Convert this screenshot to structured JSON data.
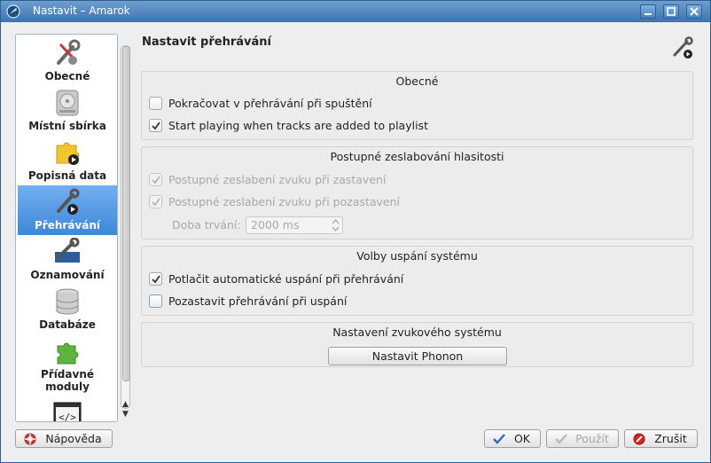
{
  "window": {
    "title": "Nastavit – Amarok"
  },
  "sidebar": {
    "items": [
      {
        "label": "Obecné",
        "icon": "wrench-screwdriver-icon",
        "selected": false
      },
      {
        "label": "Místní sbírka",
        "icon": "hard-drive-icon",
        "selected": false
      },
      {
        "label": "Popisná data",
        "icon": "puzzle-play-icon",
        "selected": false
      },
      {
        "label": "Přehrávání",
        "icon": "playback-tools-icon",
        "selected": true
      },
      {
        "label": "Oznamování",
        "icon": "notification-tools-icon",
        "selected": false
      },
      {
        "label": "Databáze",
        "icon": "database-icon",
        "selected": false
      },
      {
        "label": "Přídavné moduly",
        "icon": "plugin-puzzle-icon",
        "selected": false
      },
      {
        "label": "",
        "icon": "script-code-icon",
        "selected": false
      }
    ]
  },
  "page": {
    "title": "Nastavit přehrávání"
  },
  "groups": {
    "general": {
      "title": "Obecné",
      "resume": {
        "label": "Pokračovat v  přehrávání při spuštění",
        "checked": false
      },
      "start_playing": {
        "label": "Start playing when tracks are added to playlist",
        "checked": true
      }
    },
    "fade": {
      "title": "Postupné zeslabování hlasitosti",
      "fade_stop": {
        "label": "Postupné zeslabení zvuku při zastavení",
        "checked": true
      },
      "fade_pause": {
        "label": "Postupné zeslabení zvuku při pozastavení",
        "checked": true
      },
      "duration_label": "Doba trvání:",
      "duration_value": "2000 ms"
    },
    "sleep": {
      "title": "Volby uspání systému",
      "inhibit": {
        "label": "Potlačit automatické uspání při přehrávání",
        "checked": true
      },
      "pause_on_suspend": {
        "label": "Pozastavit přehrávání při uspání",
        "checked": false
      }
    },
    "sound": {
      "title": "Nastavení zvukového systému",
      "phonon_button": "Nastavit Phonon"
    }
  },
  "footer": {
    "help": "Nápověda",
    "ok": "OK",
    "apply": "Použít",
    "cancel": "Zrušit"
  },
  "colors": {
    "titlebar": "#3d73ad",
    "selection": "#3d88d8"
  }
}
